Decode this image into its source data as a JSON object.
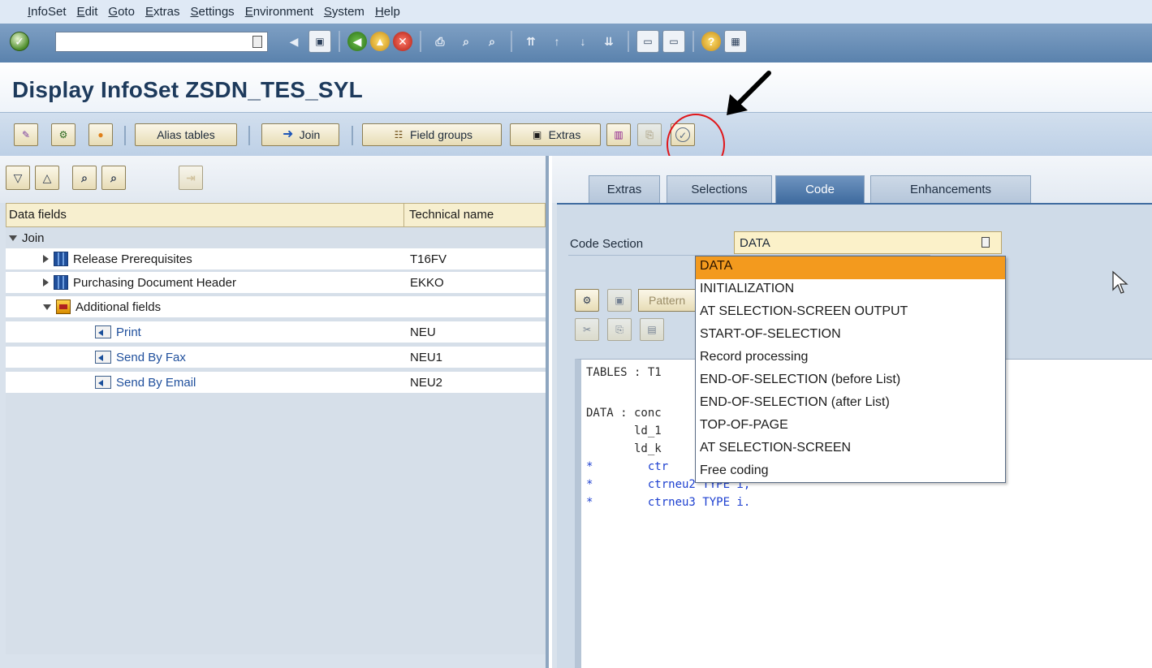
{
  "menu": [
    "InfoSet",
    "Edit",
    "Goto",
    "Extras",
    "Settings",
    "Environment",
    "System",
    "Help"
  ],
  "title": "Display InfoSet ZSDN_TES_SYL",
  "app_toolbar": {
    "alias_tables": "Alias tables",
    "join": "Join",
    "field_groups": "Field groups",
    "extras": "Extras"
  },
  "tree": {
    "col_data_fields": "Data fields",
    "col_technical_name": "Technical name",
    "root": "Join",
    "rows": [
      {
        "label": "Release Prerequisites",
        "tech": "T16FV"
      },
      {
        "label": "Purchasing Document Header",
        "tech": "EKKO"
      },
      {
        "label": "Additional fields",
        "tech": ""
      },
      {
        "label": "Print",
        "tech": "NEU"
      },
      {
        "label": "Send By Fax",
        "tech": "NEU1"
      },
      {
        "label": "Send By Email",
        "tech": "NEU2"
      }
    ]
  },
  "tabs": [
    "Extras",
    "Selections",
    "Code",
    "Enhancements"
  ],
  "active_tab": "Code",
  "code_section": {
    "label": "Code Section",
    "value": "DATA",
    "options": [
      "DATA",
      "INITIALIZATION",
      "AT SELECTION-SCREEN OUTPUT",
      "START-OF-SELECTION",
      "Record processing",
      "END-OF-SELECTION  (before List)",
      "END-OF-SELECTION  (after List)",
      "TOP-OF-PAGE",
      "AT SELECTION-SCREEN",
      "Free coding"
    ]
  },
  "code_toolbar": {
    "pattern": "Pattern"
  },
  "code_lines": [
    {
      "text": "TABLES : T1",
      "comment": false
    },
    {
      "text": "DATA : conc",
      "comment": false
    },
    {
      "text": "       ld_1",
      "comment": false
    },
    {
      "text": "       ld_k",
      "comment": false
    },
    {
      "text": "*        ctr",
      "comment": true
    },
    {
      "text": "*        ctrneu2 TYPE i,",
      "comment": true
    },
    {
      "text": "*        ctrneu3 TYPE i.",
      "comment": true
    }
  ],
  "colors": {
    "selection_highlight": "#f39a1e",
    "active_tab": "#3f6b9f",
    "callout": "#e0161a"
  }
}
